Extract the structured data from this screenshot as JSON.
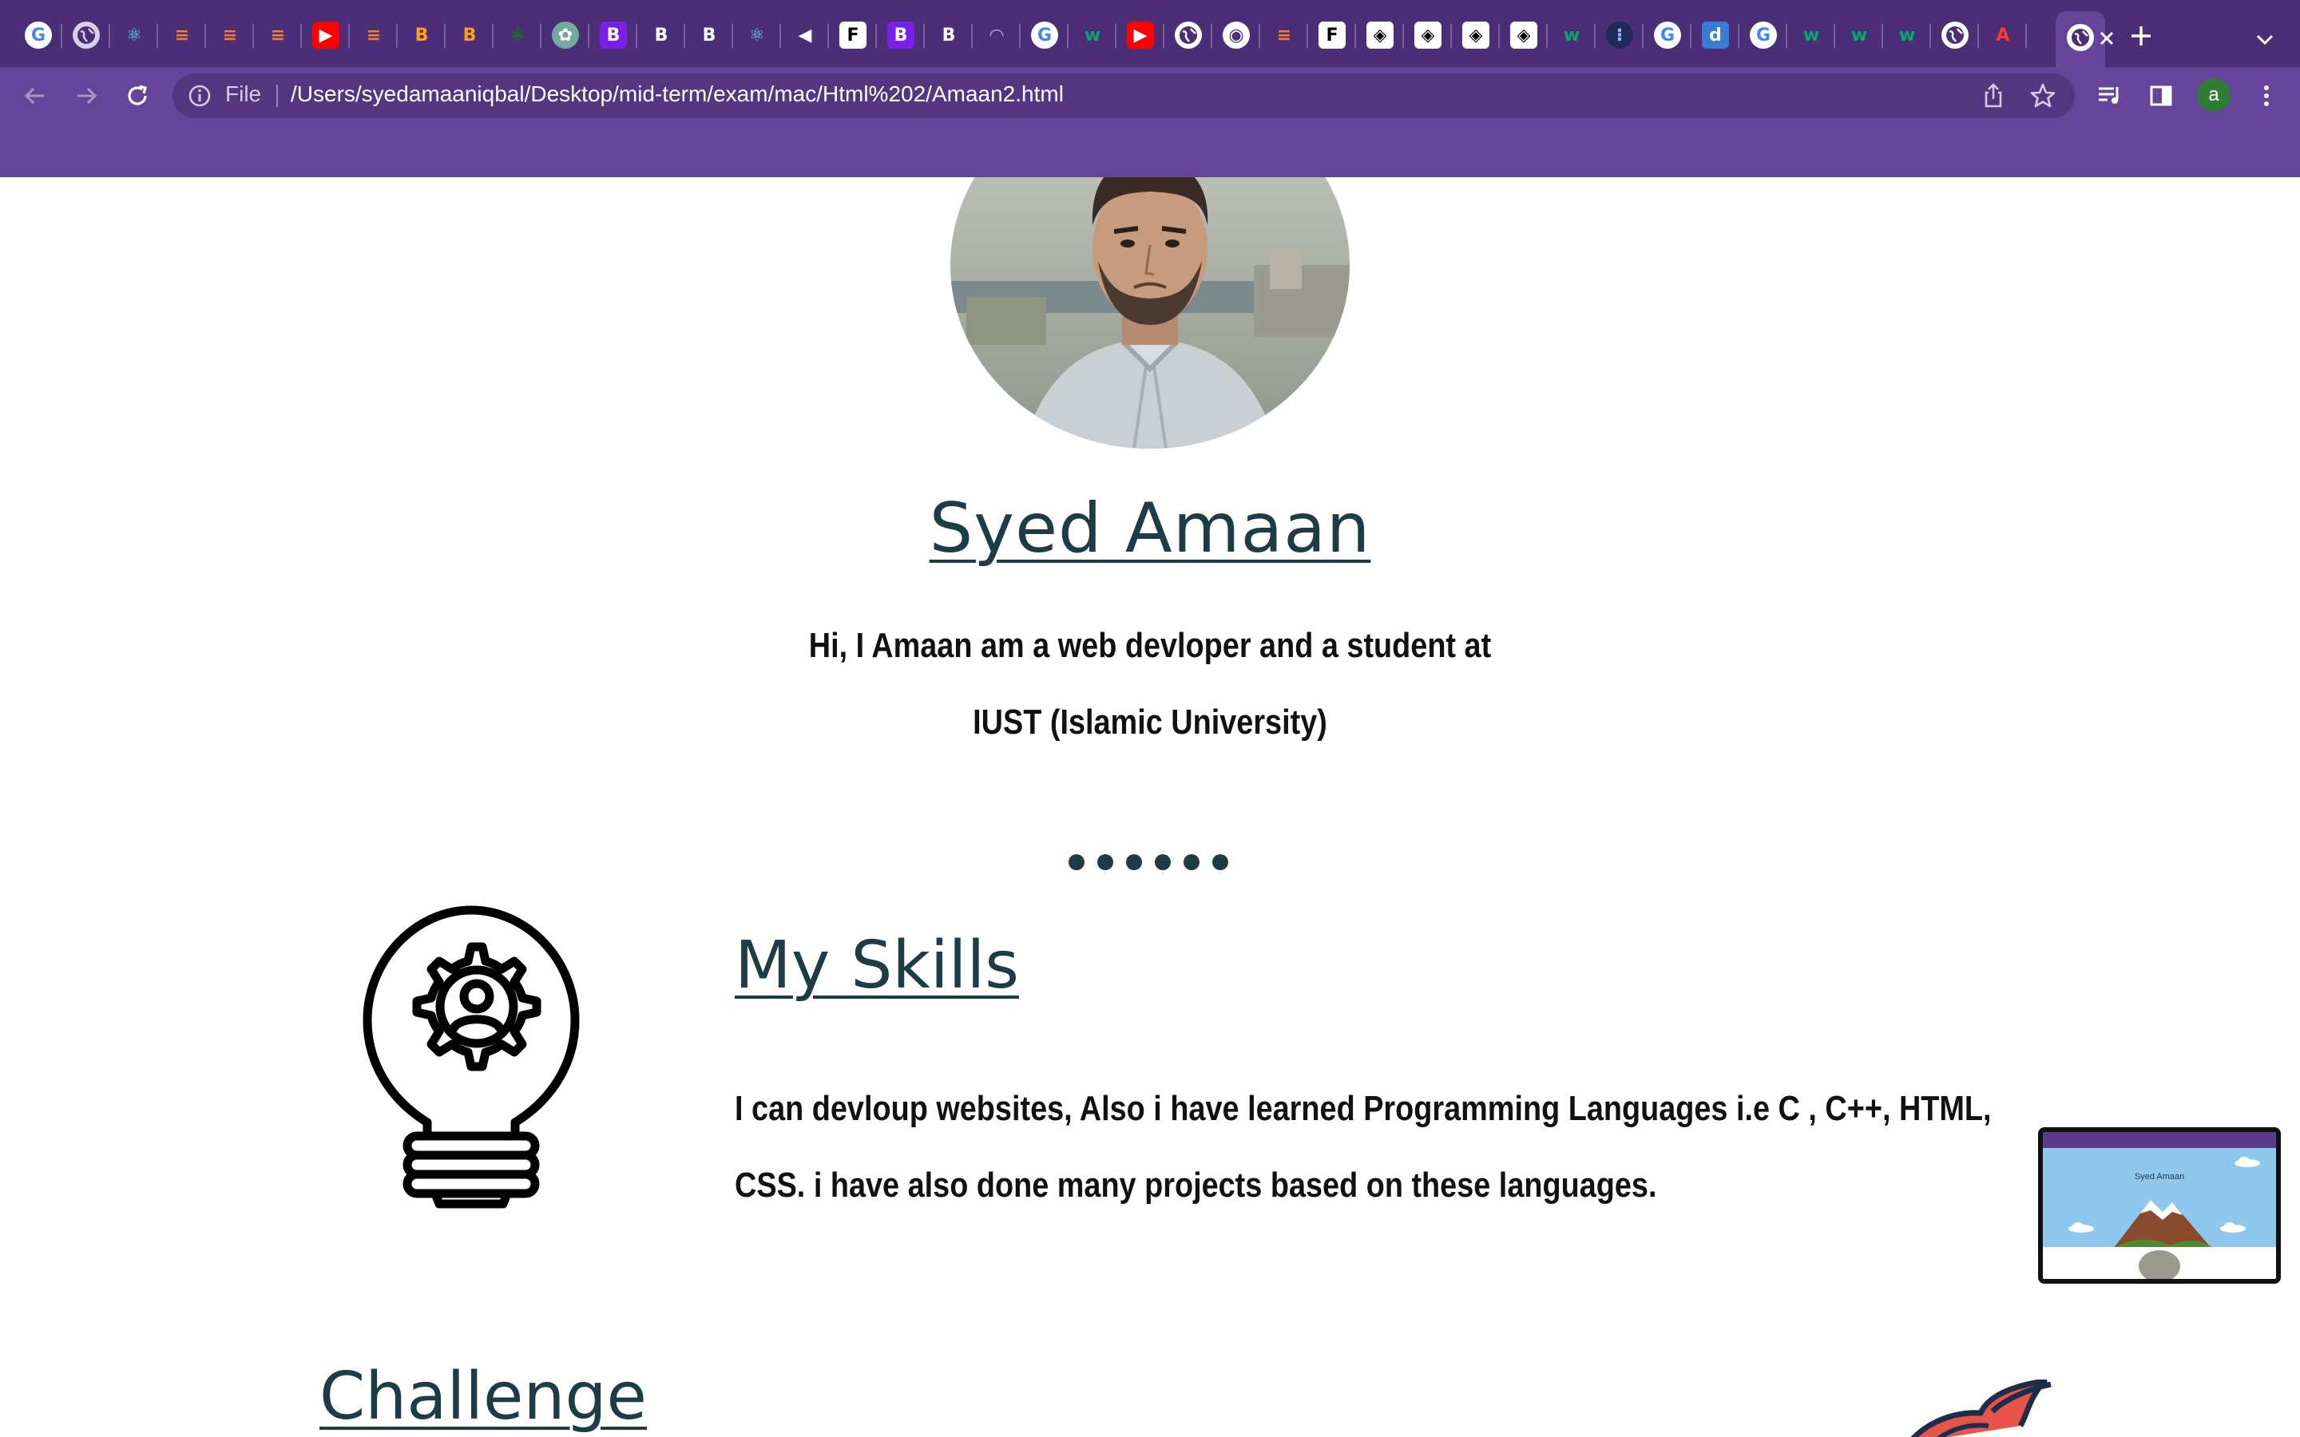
{
  "browser": {
    "tabs": [
      {
        "icon": "google-icon",
        "color": "#ffffff",
        "glyph": "G",
        "fg": "#4285f4"
      },
      {
        "icon": "globe-icon",
        "color": "#d8d0e6",
        "glyph": "",
        "fg": "#4b2d78"
      },
      {
        "icon": "react-icon",
        "color": "#4b2d78",
        "glyph": "⚛",
        "fg": "#61dafb"
      },
      {
        "icon": "stackoverflow-icon",
        "color": "#4b2d78",
        "glyph": "≡",
        "fg": "#f48024"
      },
      {
        "icon": "stackoverflow-icon",
        "color": "#4b2d78",
        "glyph": "≡",
        "fg": "#f48024"
      },
      {
        "icon": "stackoverflow-icon",
        "color": "#4b2d78",
        "glyph": "≡",
        "fg": "#f48024"
      },
      {
        "icon": "youtube-icon",
        "color": "#ff0000",
        "glyph": "▶",
        "fg": "#ffffff"
      },
      {
        "icon": "stackoverflow-icon",
        "color": "#4b2d78",
        "glyph": "≡",
        "fg": "#f48024"
      },
      {
        "icon": "bitcoin-icon",
        "color": "#4b2d78",
        "glyph": "B",
        "fg": "#ff9f1c"
      },
      {
        "icon": "bitcoin-icon",
        "color": "#4b2d78",
        "glyph": "B",
        "fg": "#ff9f1c"
      },
      {
        "icon": "leaf-icon",
        "color": "#4b2d78",
        "glyph": "✱",
        "fg": "#2a5a3a"
      },
      {
        "icon": "openai-icon",
        "color": "#74aa9c",
        "glyph": "✿",
        "fg": "#ffffff"
      },
      {
        "icon": "bootstrap-icon",
        "color": "#7a1fe6",
        "glyph": "B",
        "fg": "#ffffff"
      },
      {
        "icon": "bold-icon",
        "color": "#4b2d78",
        "glyph": "B",
        "fg": "#ffffff"
      },
      {
        "icon": "bold-icon",
        "color": "#4b2d78",
        "glyph": "B",
        "fg": "#ffffff"
      },
      {
        "icon": "react-bootstrap-icon",
        "color": "#4b2d78",
        "glyph": "⚛",
        "fg": "#61dafb"
      },
      {
        "icon": "audio-icon",
        "color": "#4b2d78",
        "glyph": "◀",
        "fg": "#ffffff"
      },
      {
        "icon": "framer-icon",
        "color": "#ffffff",
        "glyph": "F",
        "fg": "#000000"
      },
      {
        "icon": "bootstrap-icon",
        "color": "#7a1fe6",
        "glyph": "B",
        "fg": "#ffffff"
      },
      {
        "icon": "bold-icon",
        "color": "#4b2d78",
        "glyph": "B",
        "fg": "#ffffff"
      },
      {
        "icon": "loading-icon",
        "color": "#4b2d78",
        "glyph": "◠",
        "fg": "#b9a8d6"
      },
      {
        "icon": "google-icon",
        "color": "#ffffff",
        "glyph": "G",
        "fg": "#4285f4"
      },
      {
        "icon": "w3schools-icon",
        "color": "#4b2d78",
        "glyph": "w",
        "fg": "#04aa6d"
      },
      {
        "icon": "youtube-icon",
        "color": "#ff0000",
        "glyph": "▶",
        "fg": "#ffffff"
      },
      {
        "icon": "globe-icon",
        "color": "#ffffff",
        "glyph": "",
        "fg": "#4b2d78"
      },
      {
        "icon": "chrome-icon",
        "color": "#ffffff",
        "glyph": "◉",
        "fg": "#4b2d78"
      },
      {
        "icon": "stackoverflow-icon",
        "color": "#4b2d78",
        "glyph": "≡",
        "fg": "#f48024"
      },
      {
        "icon": "framer-icon",
        "color": "#ffffff",
        "glyph": "F",
        "fg": "#000000"
      },
      {
        "icon": "codepen-icon",
        "color": "#ffffff",
        "glyph": "◈",
        "fg": "#000000"
      },
      {
        "icon": "codepen-icon",
        "color": "#ffffff",
        "glyph": "◈",
        "fg": "#000000"
      },
      {
        "icon": "codepen-icon",
        "color": "#ffffff",
        "glyph": "◈",
        "fg": "#000000"
      },
      {
        "icon": "codepen-icon",
        "color": "#ffffff",
        "glyph": "◈",
        "fg": "#000000"
      },
      {
        "icon": "w3schools-icon",
        "color": "#4b2d78",
        "glyph": "w",
        "fg": "#04aa6d"
      },
      {
        "icon": "dots-icon",
        "color": "#1e2a5a",
        "glyph": "⁝",
        "fg": "#9fb4ff"
      },
      {
        "icon": "google-icon",
        "color": "#ffffff",
        "glyph": "G",
        "fg": "#4285f4"
      },
      {
        "icon": "dictionary-icon",
        "color": "#3a7bd5",
        "glyph": "d",
        "fg": "#ffffff"
      },
      {
        "icon": "google-icon",
        "color": "#ffffff",
        "glyph": "G",
        "fg": "#4285f4"
      },
      {
        "icon": "w3schools-icon",
        "color": "#4b2d78",
        "glyph": "w",
        "fg": "#04aa6d"
      },
      {
        "icon": "w3schools-icon",
        "color": "#4b2d78",
        "glyph": "w",
        "fg": "#04aa6d"
      },
      {
        "icon": "w3schools-icon",
        "color": "#4b2d78",
        "glyph": "w",
        "fg": "#04aa6d"
      },
      {
        "icon": "globe-icon",
        "color": "#ffffff",
        "glyph": "",
        "fg": "#4b2d78"
      },
      {
        "icon": "acrobat-icon",
        "color": "#4b2d78",
        "glyph": "A",
        "fg": "#ff3b30"
      }
    ],
    "active_tab": {
      "icon": "globe-icon",
      "close_icon": "close-icon"
    },
    "new_tab_icon": "plus-icon",
    "tab_search_icon": "chevron-down-icon",
    "omnibox": {
      "scheme_label": "File",
      "url": "/Users/syedamaaniqbal/Desktop/mid-term/exam/mac/Html%202/Amaan2.html"
    },
    "profile_initial": "a",
    "colors": {
      "tabstrip": "#4b2d78",
      "toolbar": "#66449a",
      "omnibox": "#54357f",
      "profile": "#2e7d32"
    }
  },
  "page": {
    "name": "Syed Amaan",
    "intro_line1": "Hi, I Amaan am a web devloper and a student at",
    "intro_line2": "IUST (Islamic University)",
    "dots_count": 6,
    "skills": {
      "title": "My Skills",
      "line1": "I can devloup websites, Also i have learned Programming Languages i.e C , C++, HTML,",
      "line2": "CSS. i have also done many projects based on these languages."
    },
    "challenge_title": "Challenge",
    "colors": {
      "heading": "#1e3c46",
      "text": "#111111"
    }
  },
  "pip": {
    "title": "Syed Amaan"
  }
}
